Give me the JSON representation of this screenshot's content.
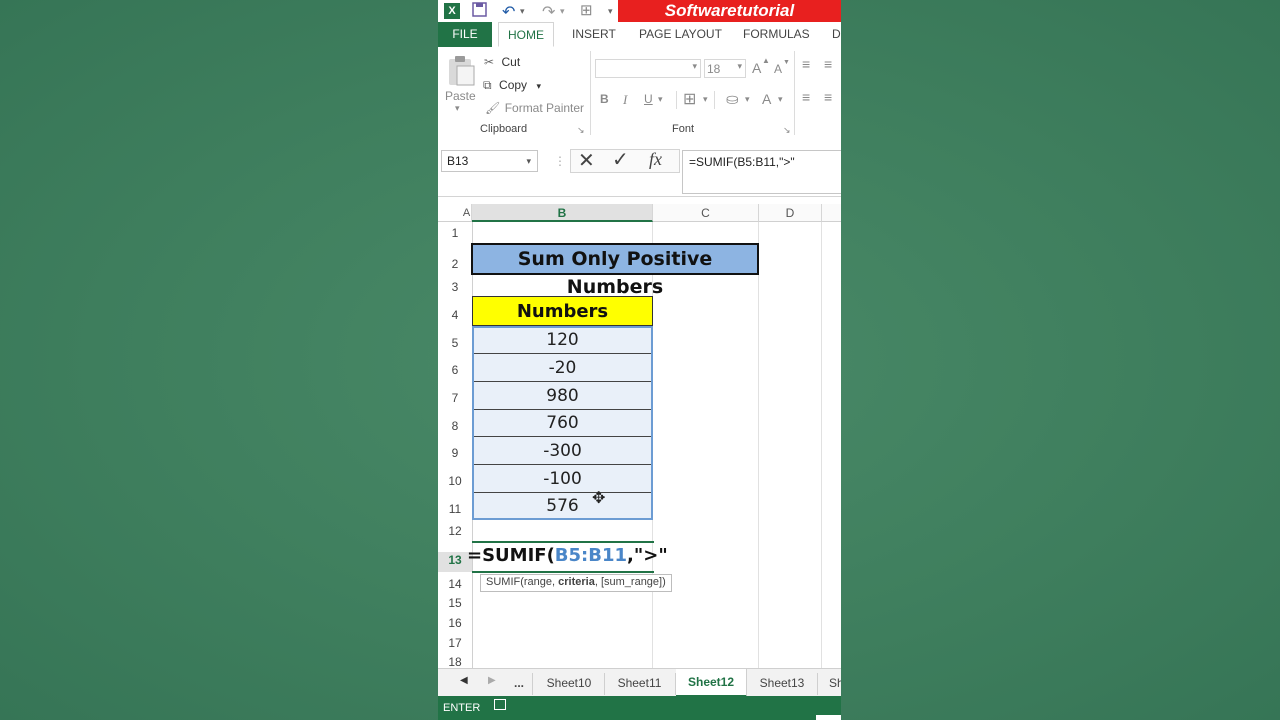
{
  "titlebar": {
    "brand": "Softwaretutorial",
    "excel_icon": "excel-icon",
    "save_icon": "save-icon",
    "undo_icon": "undo-icon",
    "redo_icon": "redo-icon"
  },
  "tabs": [
    {
      "label": "FILE"
    },
    {
      "label": "HOME"
    },
    {
      "label": "INSERT"
    },
    {
      "label": "PAGE LAYOUT"
    },
    {
      "label": "FORMULAS"
    },
    {
      "label": "D"
    }
  ],
  "ribbon": {
    "clipboard": {
      "paste": "Paste",
      "cut": "Cut",
      "copy": "Copy",
      "format_painter": "Format Painter",
      "group_label": "Clipboard"
    },
    "font": {
      "font_name": "",
      "font_size": "18",
      "grow": "A",
      "shrink": "A",
      "bold": "B",
      "italic": "I",
      "underline": "U",
      "font_color": "A",
      "group_label": "Font"
    }
  },
  "formula_bar": {
    "name_box": "B13",
    "cancel": "✕",
    "enter": "✓",
    "fx": "fx",
    "formula": "=SUMIF(B5:B11,\">\""
  },
  "grid": {
    "columns": [
      "A",
      "B",
      "C",
      "D"
    ],
    "rows": [
      "1",
      "2",
      "3",
      "4",
      "5",
      "6",
      "7",
      "8",
      "9",
      "10",
      "11",
      "12",
      "13",
      "14",
      "15",
      "16",
      "17",
      "18"
    ],
    "title": "Sum Only Positive Numbers",
    "header": "Numbers",
    "values": [
      "120",
      "-20",
      "980",
      "760",
      "-300",
      "-100",
      "576"
    ],
    "edit_prefix": "=SUMIF(",
    "edit_range": "B5:B11",
    "edit_suffix": ",\">\"",
    "tooltip_prefix": "SUMIF(range, ",
    "tooltip_bold": "criteria",
    "tooltip_suffix": ", [sum_range])"
  },
  "sheets": {
    "ellipsis": "...",
    "tabs": [
      "Sheet10",
      "Sheet11",
      "Sheet12",
      "Sheet13",
      "Sh"
    ],
    "active": "Sheet12"
  },
  "status": {
    "mode": "ENTER"
  },
  "colors": {
    "excel_green": "#217346",
    "title_fill": "#8db4e2",
    "header_fill": "#ffff00",
    "selection_fill": "#e9f0f9",
    "brand_red": "#e8201f"
  }
}
